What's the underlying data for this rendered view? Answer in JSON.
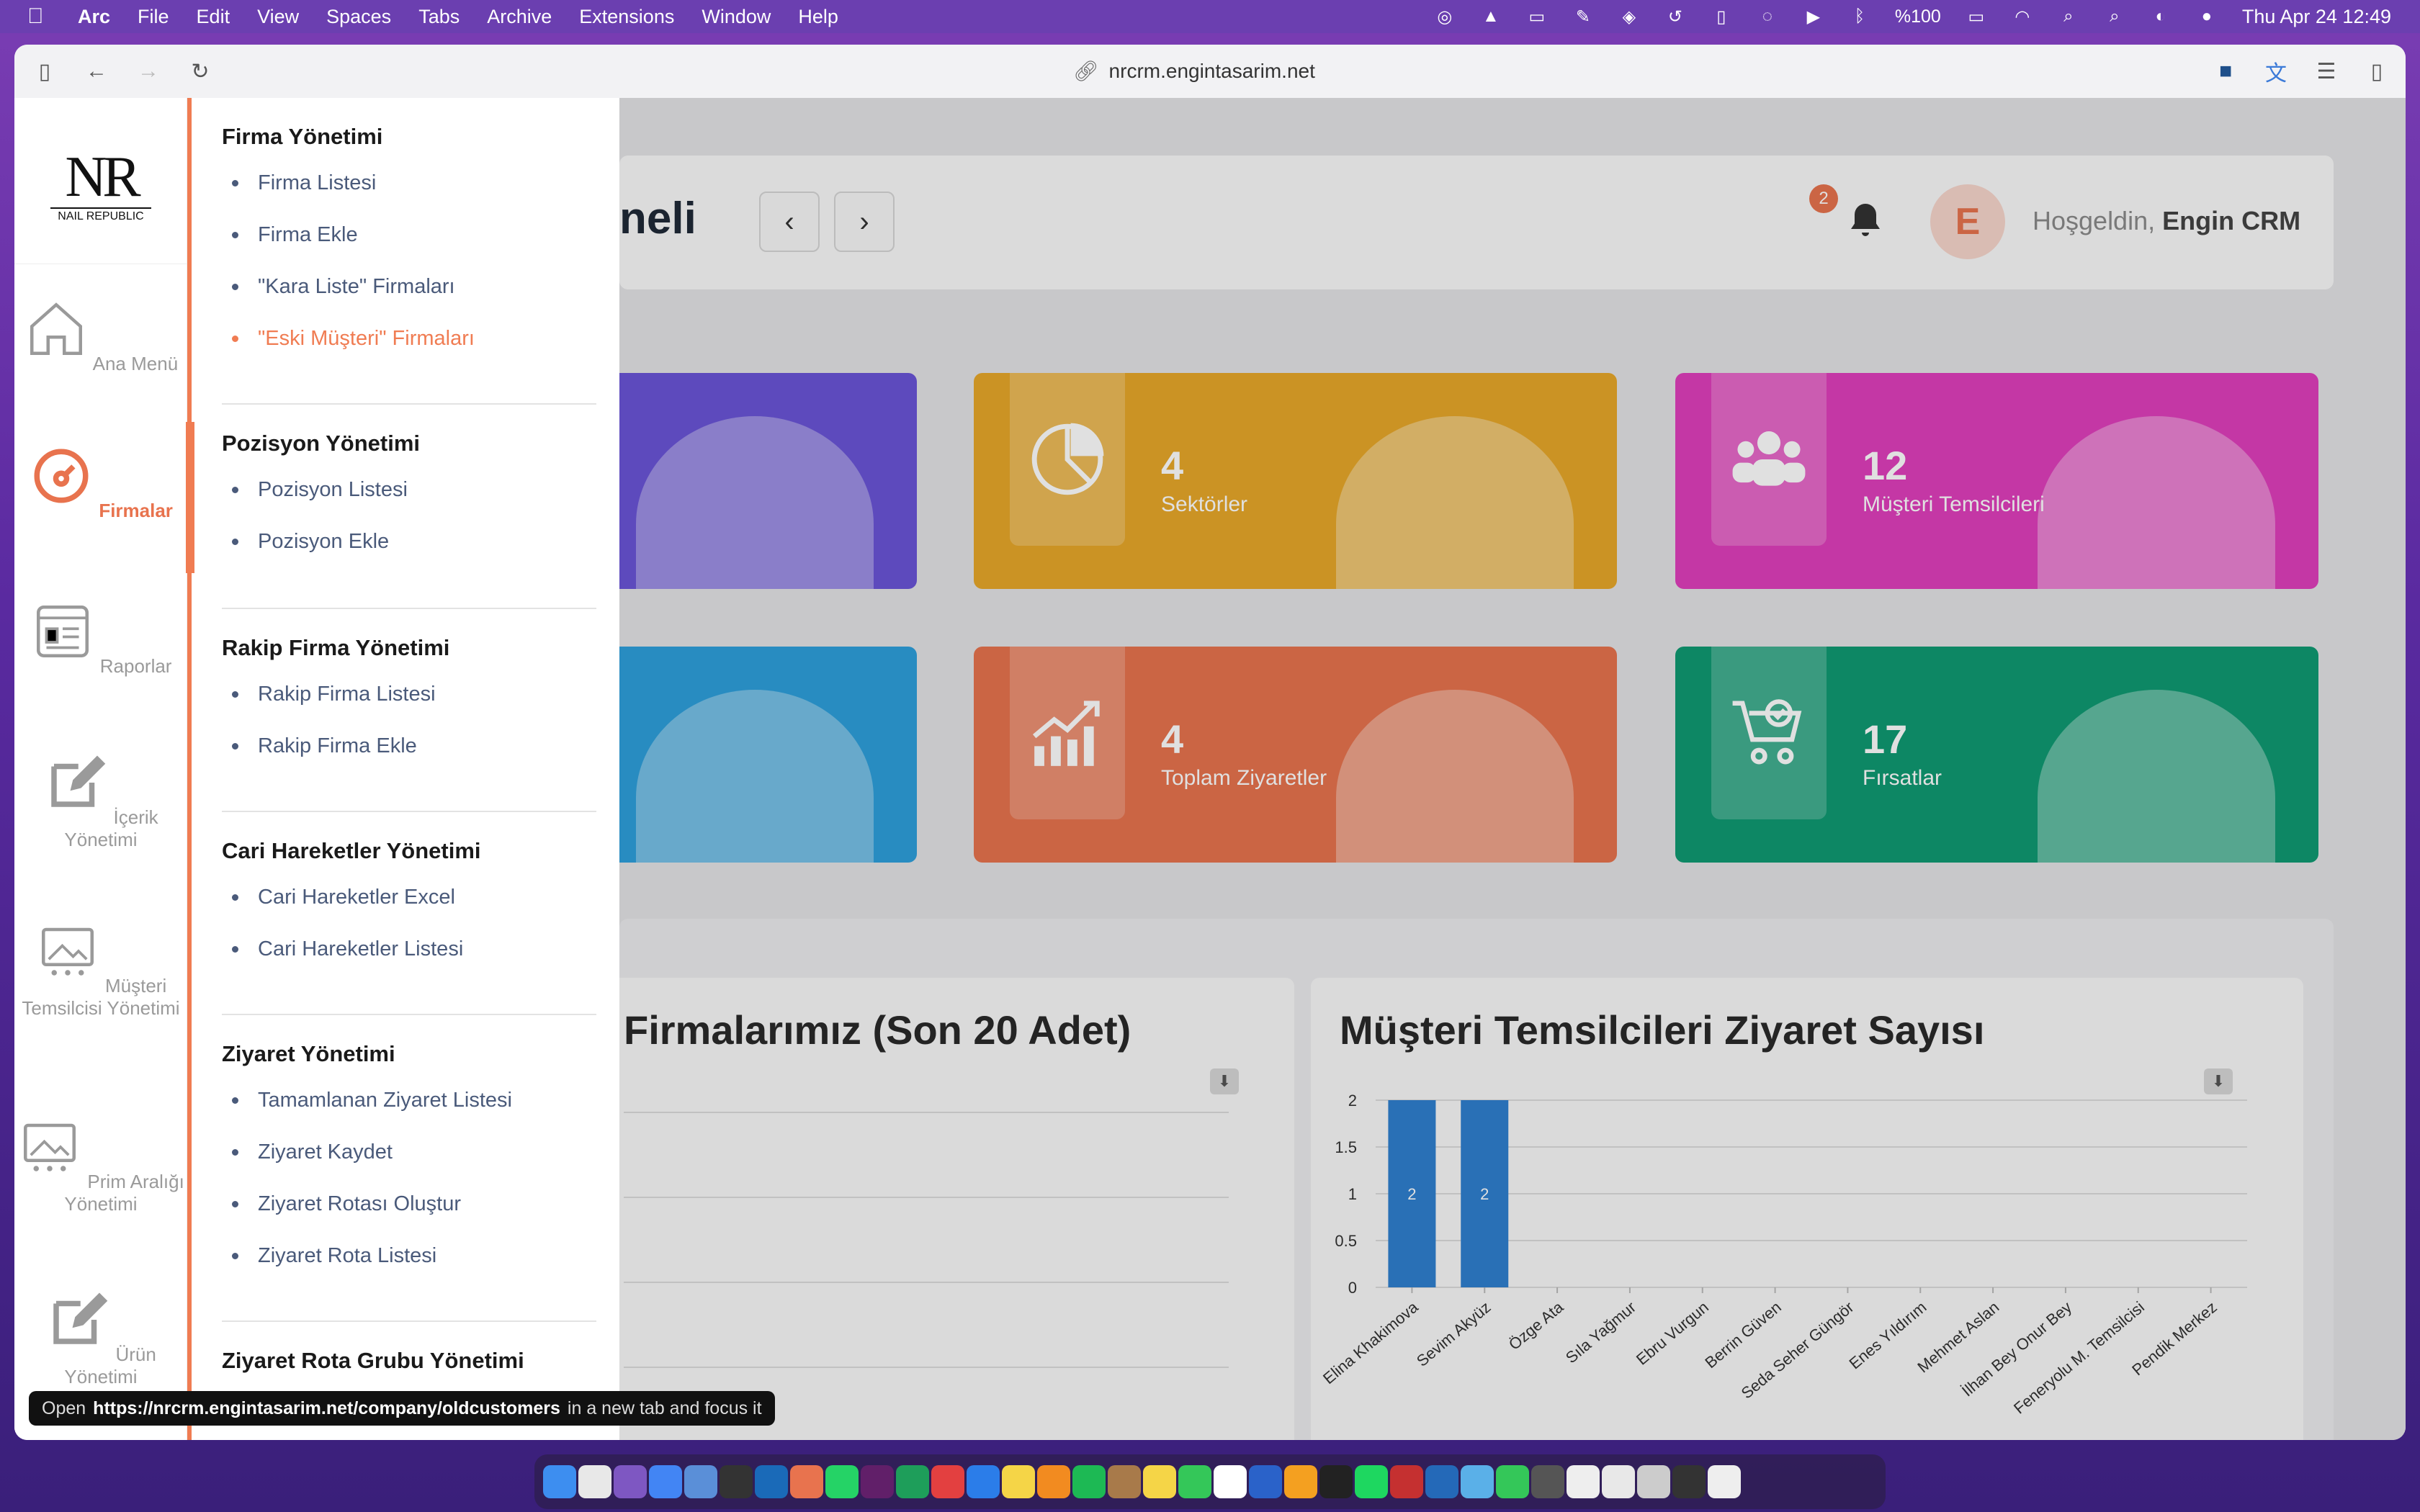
{
  "menubar": {
    "app": "Arc",
    "items": [
      "File",
      "Edit",
      "View",
      "Spaces",
      "Tabs",
      "Archive",
      "Extensions",
      "Window",
      "Help"
    ],
    "battery": "%100",
    "datetime": "Thu Apr 24  12:49"
  },
  "browser": {
    "url": "nrcrm.engintasarim.net"
  },
  "logo": {
    "text": "NR",
    "tagline": "NAIL REPUBLIC"
  },
  "sidebar": {
    "items": [
      {
        "label": "Ana Menü",
        "icon": "home-icon"
      },
      {
        "label": "Firmalar",
        "icon": "gauge-icon",
        "active": true
      },
      {
        "label": "Raporlar",
        "icon": "report-icon"
      },
      {
        "label": "İçerik Yönetimi",
        "icon": "edit-icon"
      },
      {
        "label": "Müşteri Temsilcisi Yönetimi",
        "icon": "image-icon"
      },
      {
        "label": "Prim Aralığı Yönetimi",
        "icon": "image-icon"
      },
      {
        "label": "Ürün Yönetimi",
        "icon": "edit-icon"
      }
    ]
  },
  "flyout": {
    "groups": [
      {
        "title": "Firma Yönetimi",
        "items": [
          "Firma Listesi",
          "Firma Ekle",
          "\"Kara Liste\" Firmaları",
          "\"Eski Müşteri\" Firmaları"
        ],
        "active_index": 3
      },
      {
        "title": "Pozisyon Yönetimi",
        "items": [
          "Pozisyon Listesi",
          "Pozisyon Ekle"
        ]
      },
      {
        "title": "Rakip Firma Yönetimi",
        "items": [
          "Rakip Firma Listesi",
          "Rakip Firma Ekle"
        ]
      },
      {
        "title": "Cari Hareketler Yönetimi",
        "items": [
          "Cari Hareketler Excel",
          "Cari Hareketler Listesi"
        ]
      },
      {
        "title": "Ziyaret Yönetimi",
        "items": [
          "Tamamlanan Ziyaret Listesi",
          "Ziyaret Kaydet",
          "Ziyaret Rotası Oluştur",
          "Ziyaret Rota Listesi"
        ]
      },
      {
        "title": "Ziyaret Rota Grubu Yönetimi",
        "items": []
      }
    ]
  },
  "header": {
    "title_fragment": "neli",
    "notification_count": "2",
    "avatar_initial": "E",
    "welcome": "Hoşgeldin,",
    "user": "Engin CRM"
  },
  "stats": [
    {
      "value": "",
      "label": "",
      "color": "#6a55d8"
    },
    {
      "value": "4",
      "label": "Sektörler",
      "color": "#e8a82a",
      "icon": "pie-chart-icon"
    },
    {
      "value": "12",
      "label": "Müşteri Temsilcileri",
      "color": "#e03fbc",
      "icon": "users-icon"
    },
    {
      "value": "",
      "label": "",
      "color": "#2ea0dc"
    },
    {
      "value": "4",
      "label": "Toplam Ziyaretler",
      "color": "#e8734e",
      "icon": "growth-chart-icon"
    },
    {
      "value": "17",
      "label": "Fırsatlar",
      "color": "#0f9a72",
      "icon": "cart-icon"
    }
  ],
  "charts": {
    "left_title": "Firmalarımız (Son 20 Adet)",
    "right_title": "Müşteri Temsilcileri Ziyaret Sayısı"
  },
  "chart_data": [
    {
      "type": "bar",
      "title": "Müşteri Temsilcileri Ziyaret Sayısı",
      "categories": [
        "Elina Khakimova",
        "Sevim Akyüz",
        "Özge Ata",
        "Sıla Yağmur",
        "Ebru Vurgun",
        "Berrin Güven",
        "Seda Seher Güngör",
        "Enes Yıldırım",
        "Mehmet Aslan",
        "İlhan Bey Onur Bey",
        "Feneryolu M. Temsilcisi",
        "Pendik Merkez"
      ],
      "values": [
        2,
        2,
        0,
        0,
        0,
        0,
        0,
        0,
        0,
        0,
        0,
        0
      ],
      "yticks": [
        "0",
        "0.5",
        "1",
        "1.5",
        "2"
      ],
      "ylim": [
        0,
        2
      ],
      "bar_color": "#2f80d0"
    },
    {
      "type": "bar",
      "title": "Firmalarımız (Son 20 Adet)",
      "categories": [],
      "values": []
    }
  ],
  "tooltip": {
    "prefix": "Open",
    "url": "https://nrcrm.engintasarim.net/company/oldcustomers",
    "suffix": "in a new tab and focus it"
  }
}
